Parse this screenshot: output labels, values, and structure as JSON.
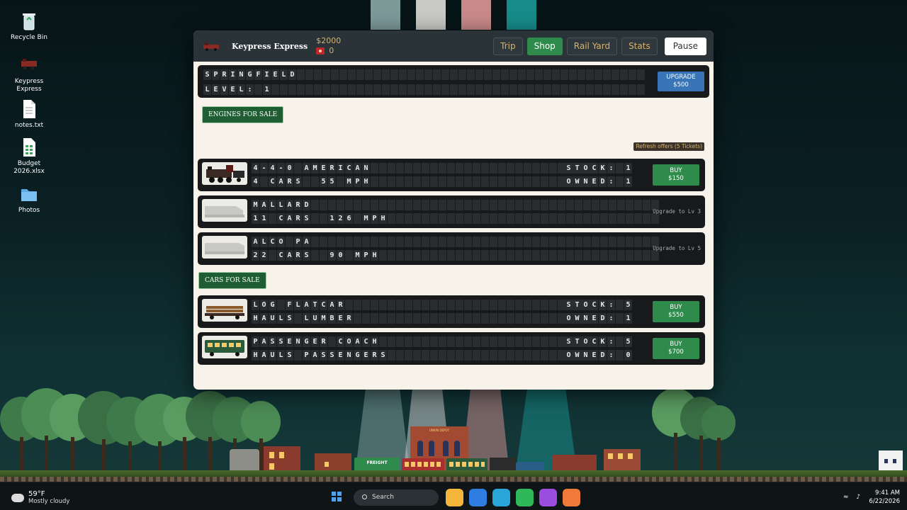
{
  "desktop": {
    "icons": [
      {
        "label": "Recycle Bin",
        "icon": "recycle-bin-icon"
      },
      {
        "label": "Keypress Express",
        "icon": "train-app-icon"
      },
      {
        "label": "notes.txt",
        "icon": "text-file-icon"
      },
      {
        "label": "Budget 2026.xlsx",
        "icon": "spreadsheet-icon"
      },
      {
        "label": "Photos",
        "icon": "folder-icon"
      }
    ]
  },
  "app": {
    "title": "Keypress Express",
    "money": "$2000",
    "tickets": "0",
    "nav": [
      "Trip",
      "Shop",
      "Rail Yard",
      "Stats"
    ],
    "active_tab": "Shop",
    "pause_label": "Pause",
    "colors": {
      "accent_green": "#2e8b4c",
      "upgrade_blue": "#3a74b8",
      "gold": "#d9b26a"
    }
  },
  "station": {
    "line1": "SPRINGFIELD",
    "line2": "LEVEL: 1",
    "upgrade_label": "UPGRADE",
    "upgrade_price": "$500"
  },
  "shop": {
    "engines_heading": "ENGINES FOR SALE",
    "refresh_label": "Refresh offers (5 Tickets)",
    "cars_heading": "CARS FOR SALE",
    "engines": [
      {
        "name": "4-4-0 AMERICAN",
        "spec": "4 CARS  55 MPH",
        "stock": "STOCK: 1",
        "owned": "OWNED: 1",
        "buy_label": "BUY",
        "price": "$150",
        "locked": false
      },
      {
        "name": "MALLARD",
        "spec": "11 CARS  126 MPH",
        "locked": true,
        "lock_note": "Upgrade to Lv 3"
      },
      {
        "name": "ALCO PA",
        "spec": "22 CARS  90 MPH",
        "locked": true,
        "lock_note": "Upgrade to Lv 5"
      }
    ],
    "cars": [
      {
        "name": "LOG FLATCAR",
        "spec": "HAULS LUMBER",
        "stock": "STOCK: 5",
        "owned": "OWNED: 1",
        "buy_label": "BUY",
        "price": "$550"
      },
      {
        "name": "PASSENGER COACH",
        "spec": "HAULS PASSENGERS",
        "stock": "STOCK: 5",
        "owned": "OWNED: 0",
        "buy_label": "BUY",
        "price": "$700"
      }
    ]
  },
  "scenery": {
    "freight_label": "FREIGHT",
    "station_sign": "UNION DEPOT"
  },
  "taskbar": {
    "temp": "59°F",
    "weather": "Mostly cloudy",
    "search_placeholder": "Search",
    "time": "9:41 AM",
    "date": "6/22/2026"
  }
}
